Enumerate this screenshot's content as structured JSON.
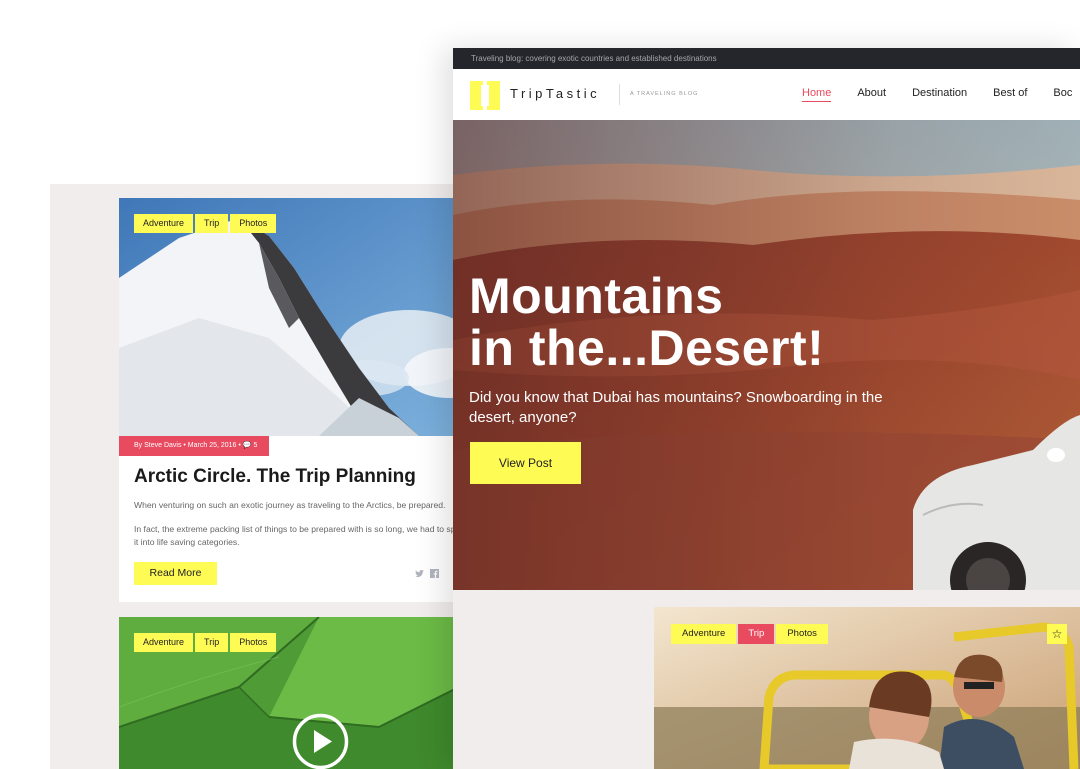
{
  "back_page": {
    "card1": {
      "tags": [
        "Adventure",
        "Trip",
        "Photos"
      ],
      "meta": "By Steve Davis • March 25, 2016 • 💬 5",
      "title": "Arctic Circle. The Trip Planning",
      "excerpt1": "When venturing on such an exotic journey as traveling to the Arctics, be prepared.",
      "excerpt2": "In fact, the extreme packing list of things to be prepared with is so long, we had to split it into life saving categories.",
      "read_more": "Read More",
      "share_icons": [
        "twitter-icon",
        "facebook-icon"
      ]
    },
    "card2": {
      "tags": [
        "Adventure",
        "Trip",
        "Photos"
      ],
      "play_icon": "play-icon"
    }
  },
  "front_page": {
    "top_bar": "Traveling blog: covering exotic countries and established destinations",
    "logo_name": "TripTastic",
    "tagline": "A TRAVELING BLOG",
    "nav": [
      "Home",
      "About",
      "Destination",
      "Best of",
      "Boc"
    ],
    "nav_active_index": 0,
    "hero": {
      "title_line1": "Mountains",
      "title_line2": "in the...Desert!",
      "subtitle": "Did you know that Dubai has mountains? Snowboarding in the desert, anyone?",
      "button": "View Post"
    },
    "card3": {
      "tags": [
        "Adventure",
        "Trip",
        "Photos"
      ],
      "active_tag": "Trip",
      "star_icon": "☆"
    }
  },
  "colors": {
    "accent_yellow": "#fffb55",
    "accent_red": "#e84a5f",
    "top_bar_bg": "#25262b"
  }
}
